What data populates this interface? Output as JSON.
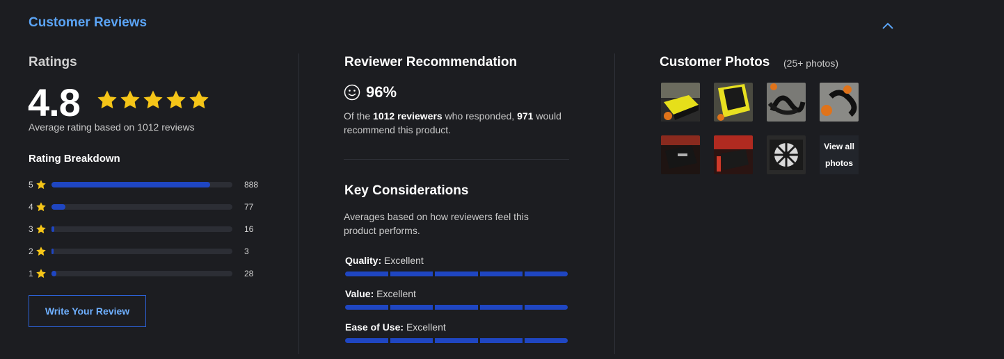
{
  "header": {
    "title": "Customer Reviews",
    "collapse_icon": "chevron-up-icon"
  },
  "ratings": {
    "title": "Ratings",
    "score": "4.8",
    "stars": 5,
    "avg_text": "Average rating based on 1012 reviews",
    "breakdown_title": "Rating Breakdown",
    "breakdown": [
      {
        "stars": "5",
        "count": "888",
        "fraction": 0.877
      },
      {
        "stars": "4",
        "count": "77",
        "fraction": 0.076
      },
      {
        "stars": "3",
        "count": "16",
        "fraction": 0.016
      },
      {
        "stars": "2",
        "count": "3",
        "fraction": 0.003
      },
      {
        "stars": "1",
        "count": "28",
        "fraction": 0.028
      }
    ],
    "write_review_label": "Write Your Review"
  },
  "recommendation": {
    "title": "Reviewer Recommendation",
    "percent": "96%",
    "text_prefix": "Of the ",
    "reviewers": "1012 reviewers",
    "text_mid": " who responded, ",
    "recommend_count": "971",
    "text_suffix": " would recommend this product."
  },
  "considerations": {
    "title": "Key Considerations",
    "description": "Averages based on how reviewers feel this product performs.",
    "items": [
      {
        "label": "Quality:",
        "value": "Excellent",
        "level": 5,
        "max": 5
      },
      {
        "label": "Value:",
        "value": "Excellent",
        "level": 5,
        "max": 5
      },
      {
        "label": "Ease of Use:",
        "value": "Excellent",
        "level": 5,
        "max": 5
      }
    ]
  },
  "photos": {
    "title": "Customer Photos",
    "count": "(25+ photos)",
    "view_all_line1": "View all",
    "view_all_line2": "photos"
  },
  "colors": {
    "accent": "#5ba4f5",
    "star": "#f5c518",
    "bar": "#1f46c2",
    "background": "#1c1d21"
  }
}
